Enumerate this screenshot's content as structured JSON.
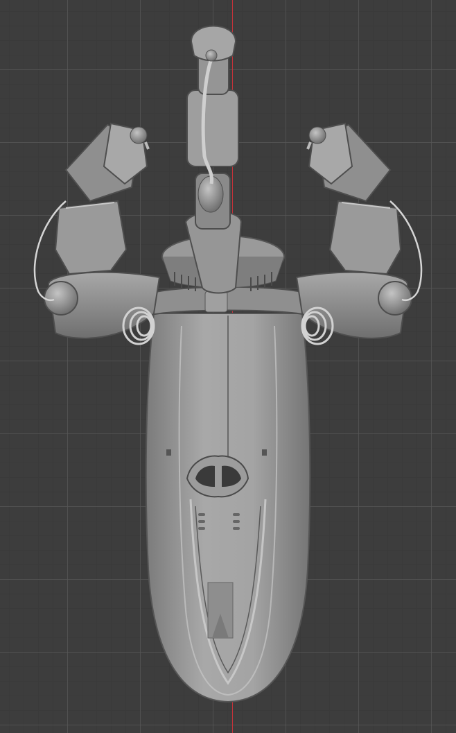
{
  "viewport": {
    "background_color": "#3d3d3d",
    "grid_color": "#555555",
    "axis_line_color": "#c2333a"
  },
  "model": {
    "shade_light": "#a3a3a3",
    "shade_mid": "#8a8a8a",
    "shade_dark": "#5c5c5c",
    "outline": "#4a4a4a",
    "highlight": "#cfcfcf"
  }
}
